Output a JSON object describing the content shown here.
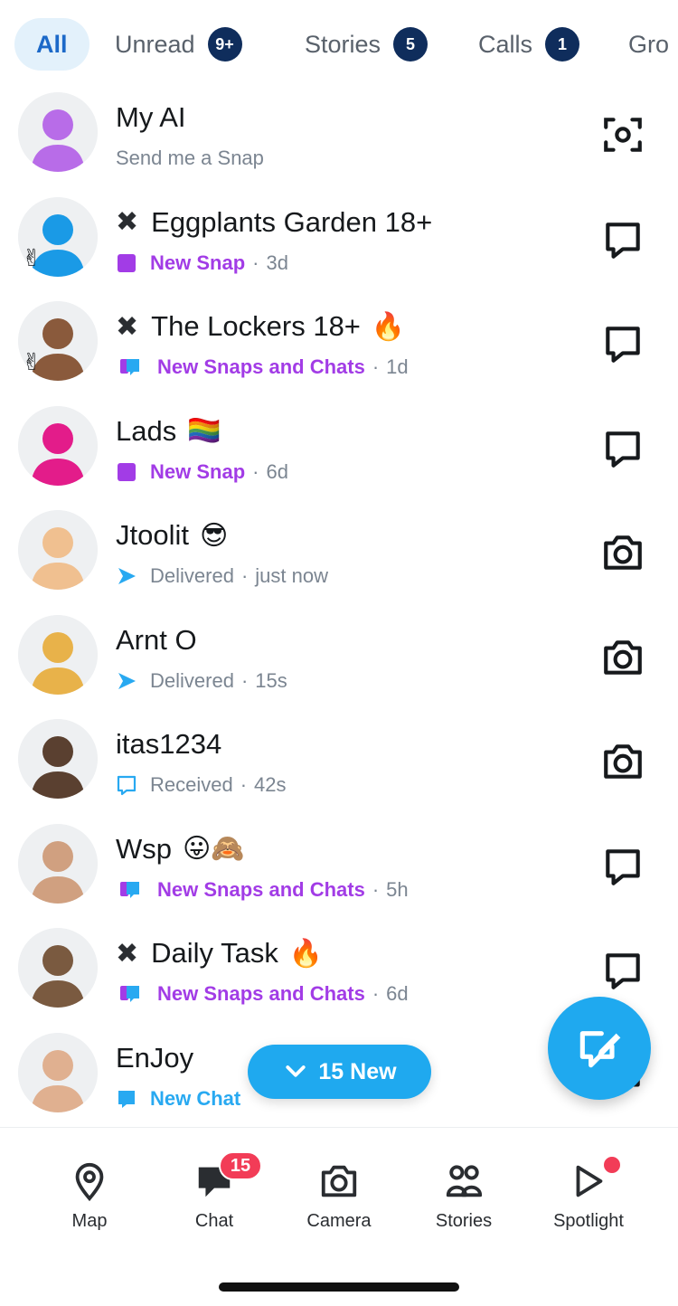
{
  "tabs": [
    {
      "label": "All",
      "count": ""
    },
    {
      "label": "Unread",
      "count": "9+"
    },
    {
      "label": "Stories",
      "count": "5"
    },
    {
      "label": "Calls",
      "count": "1"
    },
    {
      "label": "Gro",
      "count": ""
    }
  ],
  "chats": [
    {
      "name": "My AI",
      "prefix": "",
      "emoji": "",
      "status_text": "Send me a Snap",
      "status_kind": "plain",
      "time": "",
      "status_icon": "none",
      "right_icon": "camera-scan-icon"
    },
    {
      "name": "Eggplants Garden 18+",
      "prefix": "✖",
      "emoji": "",
      "status_text": "New Snap",
      "status_kind": "purple",
      "time": "3d",
      "status_icon": "snap-square-icon",
      "right_icon": "chat-bubble-icon"
    },
    {
      "name": "The Lockers 18+",
      "prefix": "✖",
      "emoji": "🔥",
      "status_text": "New Snaps and Chats",
      "status_kind": "purple",
      "time": "1d",
      "status_icon": "snaps-chats-icon",
      "right_icon": "chat-bubble-icon"
    },
    {
      "name": "Lads",
      "prefix": "",
      "emoji": "🏳️‍🌈",
      "status_text": "New Snap",
      "status_kind": "purple",
      "time": "6d",
      "status_icon": "snap-square-icon",
      "right_icon": "chat-bubble-icon"
    },
    {
      "name": "Jtoolit",
      "prefix": "",
      "emoji": "😎",
      "status_text": "Delivered",
      "status_kind": "gray",
      "time": "just now",
      "status_icon": "sent-arrow-icon",
      "right_icon": "camera-icon"
    },
    {
      "name": "Arnt O",
      "prefix": "",
      "emoji": "",
      "status_text": "Delivered",
      "status_kind": "gray",
      "time": "15s",
      "status_icon": "sent-arrow-icon",
      "right_icon": "camera-icon"
    },
    {
      "name": "itas1234",
      "prefix": "",
      "emoji": "",
      "status_text": "Received",
      "status_kind": "gray",
      "time": "42s",
      "status_icon": "received-chat-icon",
      "right_icon": "camera-icon"
    },
    {
      "name": "Wsp",
      "prefix": "",
      "emoji": "😛🙈",
      "status_text": "New Snaps and Chats",
      "status_kind": "purple",
      "time": "5h",
      "status_icon": "snaps-chats-icon",
      "right_icon": "chat-bubble-icon"
    },
    {
      "name": "Daily Task",
      "prefix": "✖",
      "emoji": "🔥",
      "status_text": "New Snaps and Chats",
      "status_kind": "purple",
      "time": "6d",
      "status_icon": "snaps-chats-icon",
      "right_icon": "chat-bubble-icon"
    },
    {
      "name": "EnJoy",
      "prefix": "",
      "emoji": "",
      "status_text": "New Chat",
      "status_kind": "blue",
      "time": "",
      "status_icon": "new-chat-icon",
      "right_icon": "chat-bubble-icon"
    }
  ],
  "new_pill": {
    "label": "15 New"
  },
  "nav": {
    "items": [
      {
        "label": "Map",
        "icon": "map-pin-icon"
      },
      {
        "label": "Chat",
        "icon": "chat-icon",
        "badge": "15"
      },
      {
        "label": "Camera",
        "icon": "camera-icon"
      },
      {
        "label": "Stories",
        "icon": "stories-icon"
      },
      {
        "label": "Spotlight",
        "icon": "spotlight-icon"
      }
    ]
  },
  "colors": {
    "accent_blue": "#1fa9ef",
    "purple": "#a23ce6",
    "badge_navy": "#0f2d5c",
    "badge_red": "#f23c57"
  }
}
